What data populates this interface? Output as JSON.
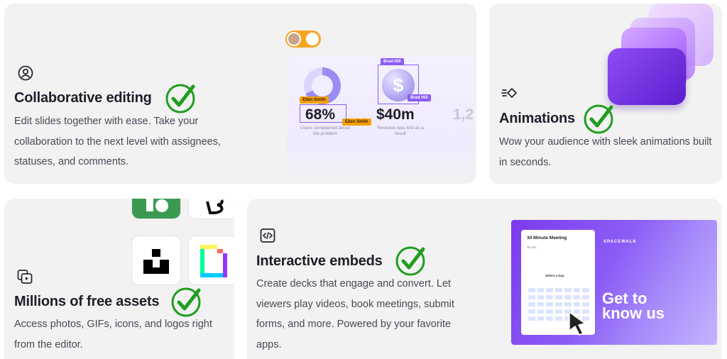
{
  "features": {
    "collab": {
      "title": "Collaborative editing",
      "desc": "Edit slides together with ease. Take your collaboration to the next level with assignees, statuses, and comments.",
      "icon": "user-circle-icon",
      "preview": {
        "tag_ellen": "Ellen Smith",
        "tag_brad": "Brad Hill",
        "stat1_value": "68%",
        "stat1_caption": "Users complained about the problem",
        "stat2_value": "$40m",
        "stat2_caption": "Revenue was lost as a result",
        "stat3_value": "1,2",
        "coin_symbol": "$"
      }
    },
    "animations": {
      "title": "Animations",
      "desc": "Wow your audience with sleek animations built in seconds.",
      "icon": "animation-icon"
    },
    "assets": {
      "title": "Millions of free assets",
      "desc": "Access photos, GIFs, icons, and logos right from the editor.",
      "icon": "media-library-icon"
    },
    "embeds": {
      "title": "Interactive embeds",
      "desc": "Create decks that engage and convert. Let viewers play videos, book meetings, submit forms, and more. Powered by your favorite apps.",
      "icon": "code-embed-icon",
      "preview": {
        "meeting_title": "30 Minute Meeting",
        "duration": "30 min",
        "select_day": "Select a Day",
        "brand": "SPACEWALK",
        "cta_line1": "Get to",
        "cta_line2": "know us"
      }
    }
  },
  "colors": {
    "card_bg": "#f2f2f2",
    "check_green": "#1f9d1f",
    "accent_purple": "#8b5cf6"
  }
}
